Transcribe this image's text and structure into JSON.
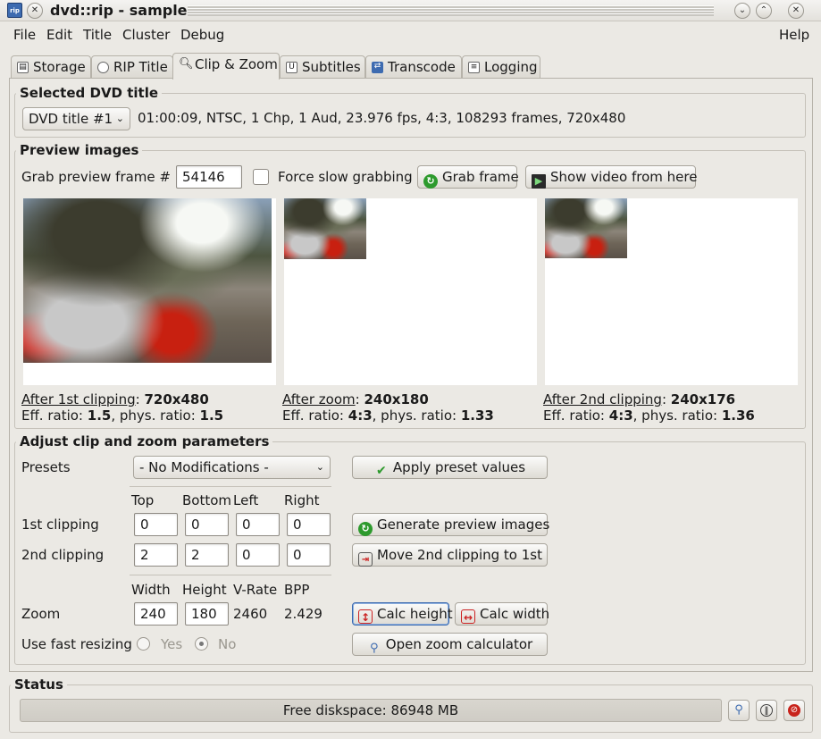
{
  "window": {
    "title": "dvd::rip - sample",
    "app_icon_text": "rip"
  },
  "menu": {
    "items": [
      "File",
      "Edit",
      "Title",
      "Cluster",
      "Debug"
    ],
    "help": "Help"
  },
  "tabs": [
    {
      "label": "Storage",
      "icon": "disk-icon"
    },
    {
      "label": "RIP Title",
      "icon": "cd-icon"
    },
    {
      "label": "Clip & Zoom",
      "icon": "magnifier-icon",
      "active": true
    },
    {
      "label": "Subtitles",
      "icon": "subtitle-icon"
    },
    {
      "label": "Transcode",
      "icon": "transcode-icon"
    },
    {
      "label": "Logging",
      "icon": "log-icon"
    }
  ],
  "selected_title": {
    "heading": "Selected DVD title",
    "select_value": "DVD title #1",
    "info": "01:00:09, NTSC, 1 Chp, 1 Aud, 23.976 fps, 4:3, 108293 frames, 720x480"
  },
  "preview": {
    "heading": "Preview images",
    "grab_label": "Grab preview frame #",
    "frame_value": "54146",
    "force_slow_label": "Force slow grabbing",
    "grab_button": "Grab frame",
    "show_video_button": "Show video from here",
    "images": [
      {
        "link": "After 1st clipping",
        "size": "720x480",
        "eff_label": "Eff. ratio: ",
        "eff": "1.5",
        "phys_label": ", phys. ratio: ",
        "phys": "1.5"
      },
      {
        "link": "After zoom",
        "size": "240x180",
        "eff_label": "Eff. ratio: ",
        "eff": "4:3",
        "phys_label": ", phys. ratio: ",
        "phys": "1.33"
      },
      {
        "link": "After 2nd clipping",
        "size": "240x176",
        "eff_label": "Eff. ratio: ",
        "eff": "4:3",
        "phys_label": ", phys. ratio: ",
        "phys": "1.36"
      }
    ]
  },
  "adjust": {
    "heading": "Adjust clip and zoom parameters",
    "presets_label": "Presets",
    "preset_value": "- No Modifications -",
    "apply_button": "Apply preset values",
    "col_headers": [
      "Top",
      "Bottom",
      "Left",
      "Right"
    ],
    "clip1_label": "1st clipping",
    "clip1": [
      "0",
      "0",
      "0",
      "0"
    ],
    "clip2_label": "2nd clipping",
    "clip2": [
      "2",
      "2",
      "0",
      "0"
    ],
    "generate_button": "Generate preview images",
    "move_button": "Move 2nd clipping to 1st",
    "zoom_headers": [
      "Width",
      "Height",
      "V-Rate",
      "BPP"
    ],
    "zoom_label": "Zoom",
    "zoom_width": "240",
    "zoom_height": "180",
    "vrate": "2460",
    "bpp": "2.429",
    "calc_height_button": "Calc height",
    "calc_width_button": "Calc width",
    "fast_resize_label": "Use fast resizing",
    "yes_label": "Yes",
    "no_label": "No",
    "zoom_calc_button": "Open zoom calculator"
  },
  "status": {
    "heading": "Status",
    "text": "Free diskspace: 86948 MB"
  }
}
